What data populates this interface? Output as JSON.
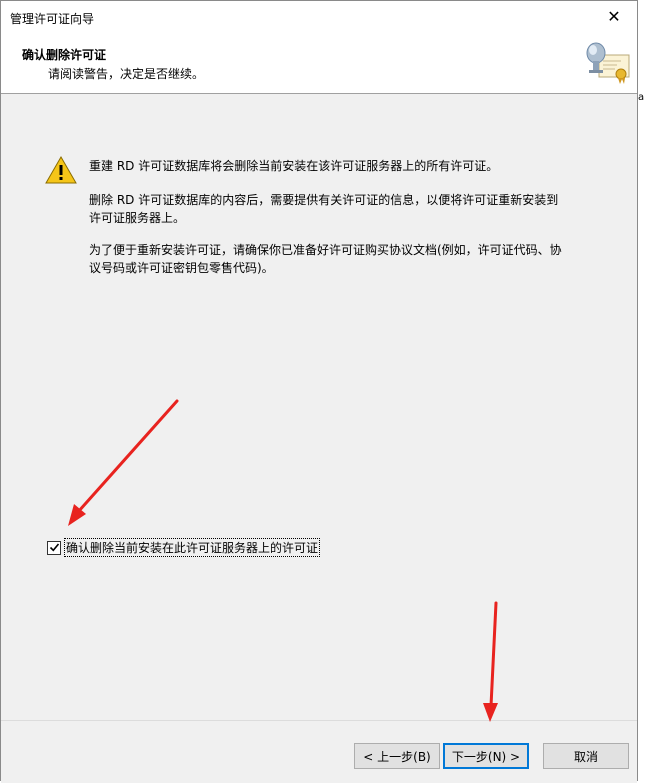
{
  "window": {
    "title": "管理许可证向导",
    "close_glyph": "✕"
  },
  "header": {
    "title": "确认删除许可证",
    "subtitle": "请阅读警告，决定是否继续。"
  },
  "body": {
    "paragraphs": [
      "重建 RD 许可证数据库将会删除当前安装在该许可证服务器上的所有许可证。",
      "删除 RD 许可证数据库的内容后，需要提供有关许可证的信息，以便将许可证重新安装到许可证服务器上。",
      "为了便于重新安装许可证，请确保你已准备好许可证购买协议文档(例如，许可证代码、协议号码或许可证密钥包零售代码)。"
    ],
    "confirm_checkbox": {
      "label": "确认删除当前安装在此许可证服务器上的许可证",
      "checked": true
    }
  },
  "footer": {
    "back_label": "< 上一步(B)",
    "next_label": "下一步(N) >",
    "cancel_label": "取消"
  },
  "colors": {
    "annotation_arrow": "#e8231f",
    "focus_border": "#0078d7",
    "warning_yellow": "#f5c518"
  },
  "right_edge_text": "a"
}
